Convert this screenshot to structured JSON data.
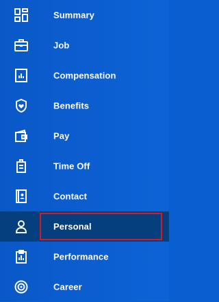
{
  "navigation": {
    "items": [
      {
        "label": "Summary",
        "icon": "summary-grid-icon"
      },
      {
        "label": "Job",
        "icon": "briefcase-icon"
      },
      {
        "label": "Compensation",
        "icon": "compensation-chart-icon"
      },
      {
        "label": "Benefits",
        "icon": "heart-shield-icon"
      },
      {
        "label": "Pay",
        "icon": "wallet-icon"
      },
      {
        "label": "Time Off",
        "icon": "time-off-icon"
      },
      {
        "label": "Contact",
        "icon": "contact-book-icon"
      },
      {
        "label": "Personal",
        "icon": "person-icon",
        "selected": true
      },
      {
        "label": "Performance",
        "icon": "clipboard-chart-icon"
      },
      {
        "label": "Career",
        "icon": "target-icon"
      }
    ]
  },
  "colors": {
    "background": "#0b5ed0",
    "selected_background": "#063f7d",
    "text": "#ffffff",
    "highlight_border": "#d11b2d"
  }
}
